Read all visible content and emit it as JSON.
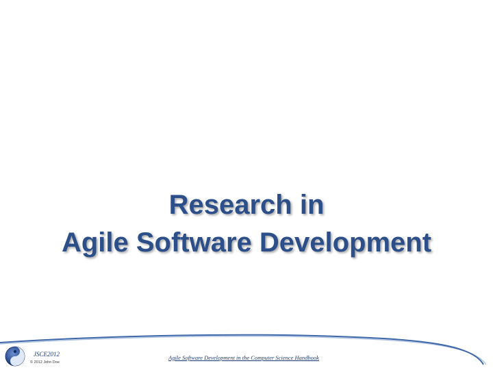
{
  "slide": {
    "title_line1": "Research in",
    "title_line2": "Agile Software Development"
  },
  "footer": {
    "conference": "JSCE2012",
    "copyright": "© 2012  John Doe",
    "handbook_title": "Agile Software Development in the Computer Science Handbook"
  },
  "colors": {
    "title": "#2c4f8a",
    "footer_curve": "#4a78b8"
  }
}
